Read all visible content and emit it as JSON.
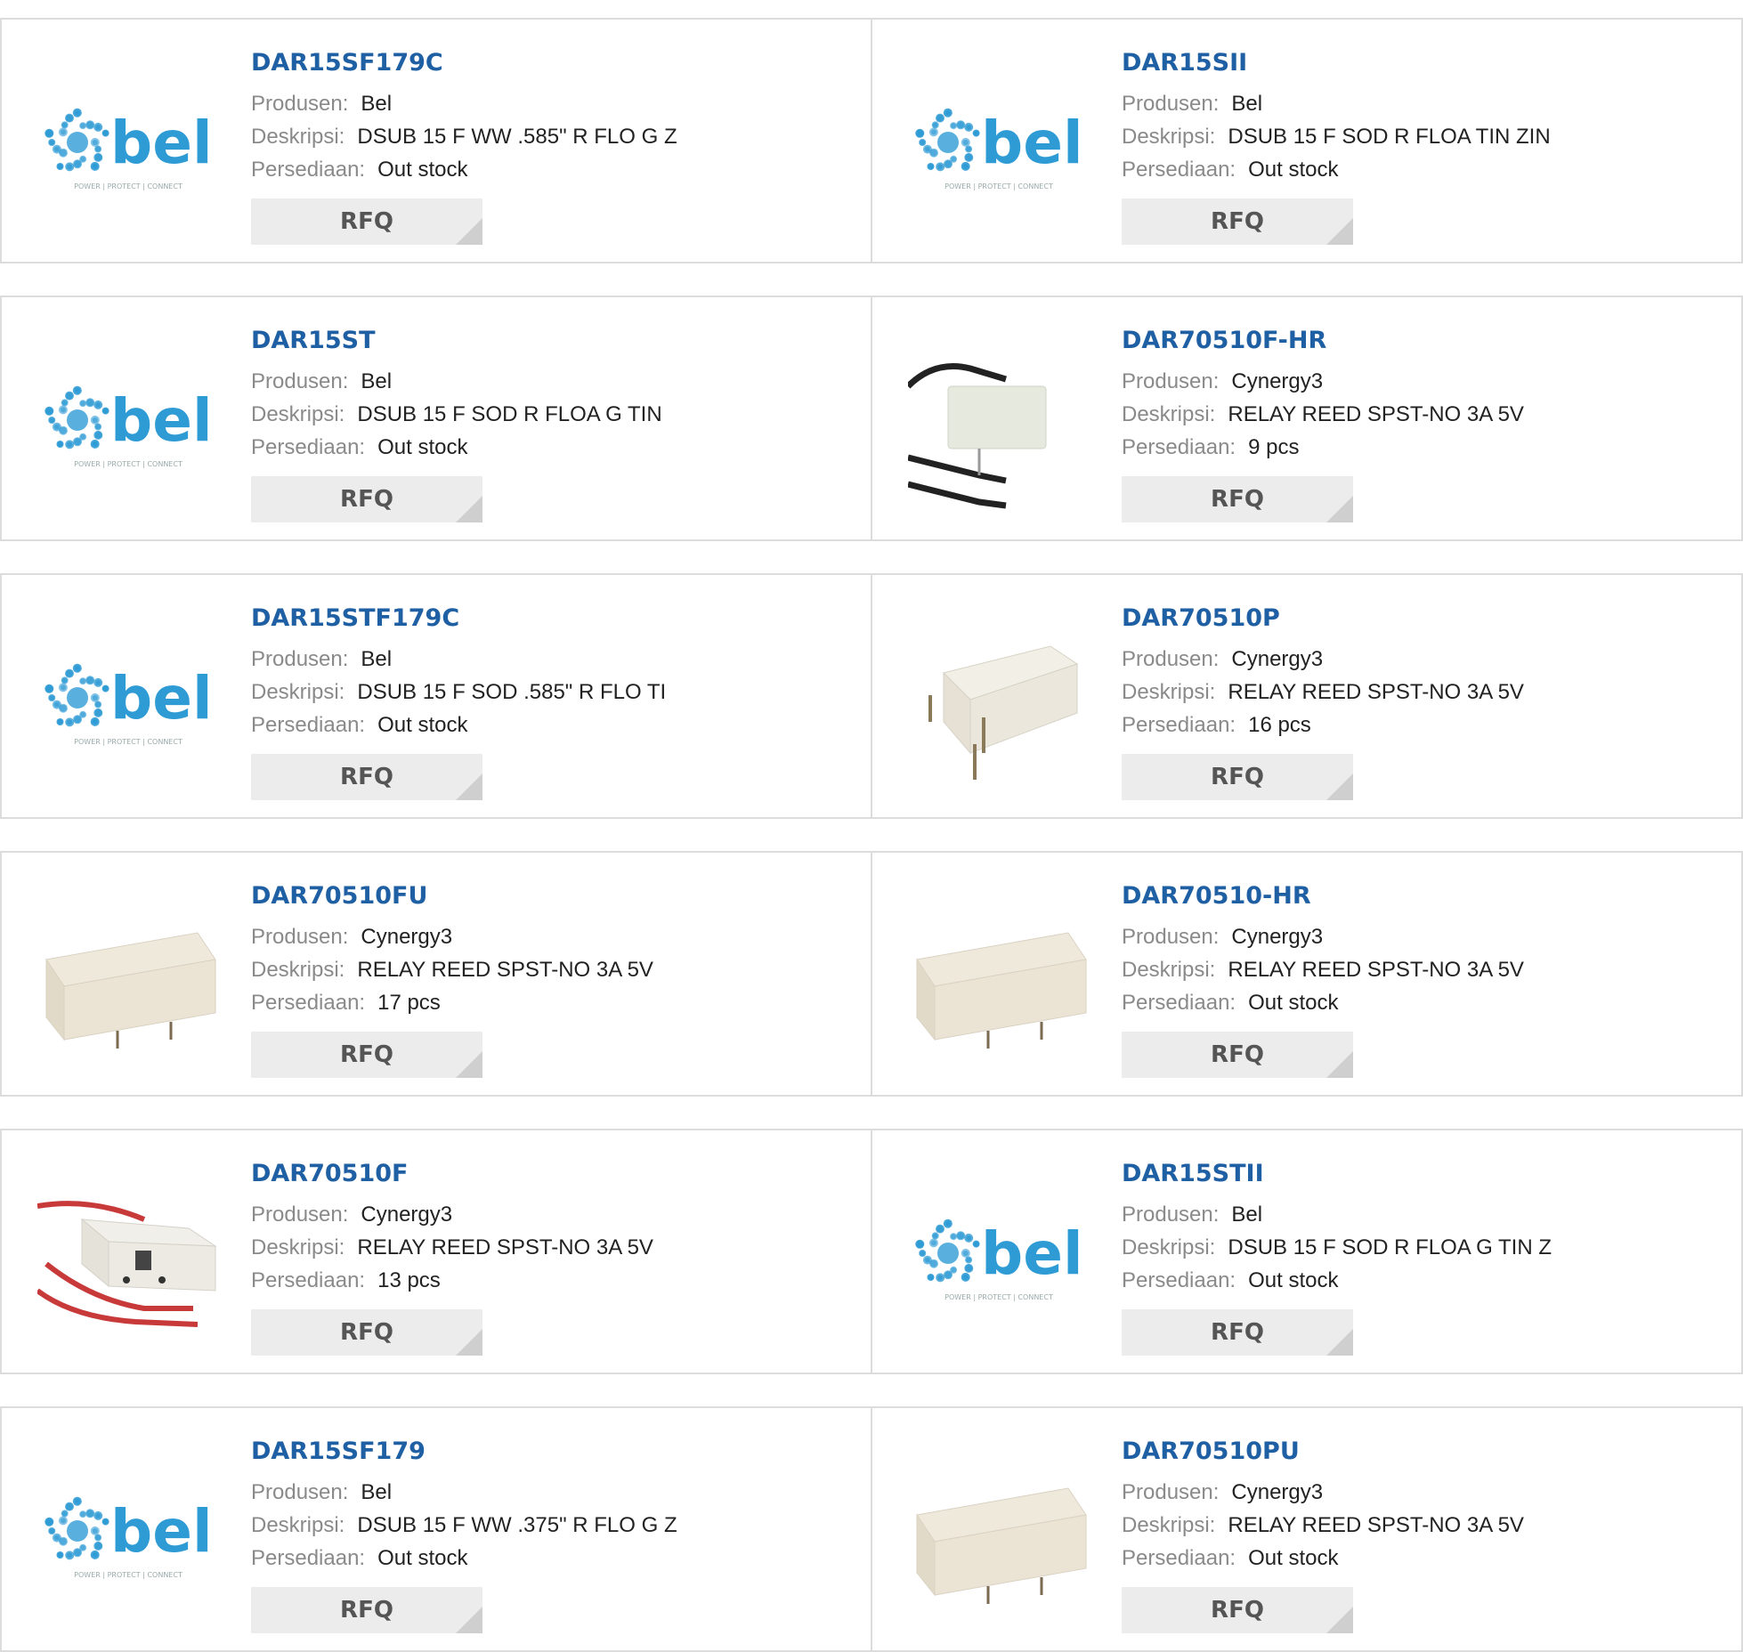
{
  "labels": {
    "manufacturer": "Produsen:",
    "description": "Deskripsi:",
    "stock": "Persediaan:",
    "rfq": "RFQ"
  },
  "colors": {
    "link": "#1f5fa3",
    "border": "#dcdcdc",
    "button": "#ececec",
    "bel_logo": "#2f9bd5"
  },
  "products": [
    {
      "part": "DAR15SF179C",
      "manufacturer": "Bel",
      "description": "DSUB 15 F WW .585\" R FLO G Z",
      "stock": "Out stock",
      "image": "bel-logo"
    },
    {
      "part": "DAR15SII",
      "manufacturer": "Bel",
      "description": "DSUB 15 F SOD R FLOA TIN ZIN",
      "stock": "Out stock",
      "image": "bel-logo"
    },
    {
      "part": "DAR15ST",
      "manufacturer": "Bel",
      "description": "DSUB 15 F SOD R FLOA G TIN",
      "stock": "Out stock",
      "image": "bel-logo"
    },
    {
      "part": "DAR70510F-HR",
      "manufacturer": "Cynergy3",
      "description": "RELAY REED SPST-NO 3A 5V",
      "stock": "9 pcs",
      "image": "relay-black-wires"
    },
    {
      "part": "DAR15STF179C",
      "manufacturer": "Bel",
      "description": "DSUB 15 F SOD .585\" R FLO TI",
      "stock": "Out stock",
      "image": "bel-logo"
    },
    {
      "part": "DAR70510P",
      "manufacturer": "Cynergy3",
      "description": "RELAY REED SPST-NO 3A 5V",
      "stock": "16 pcs",
      "image": "relay-pins"
    },
    {
      "part": "DAR70510FU",
      "manufacturer": "Cynergy3",
      "description": "RELAY REED SPST-NO 3A 5V",
      "stock": "17 pcs",
      "image": "relay-block"
    },
    {
      "part": "DAR70510-HR",
      "manufacturer": "Cynergy3",
      "description": "RELAY REED SPST-NO 3A 5V",
      "stock": "Out stock",
      "image": "relay-block"
    },
    {
      "part": "DAR70510F",
      "manufacturer": "Cynergy3",
      "description": "RELAY REED SPST-NO 3A 5V",
      "stock": "13 pcs",
      "image": "relay-red-wires"
    },
    {
      "part": "DAR15STII",
      "manufacturer": "Bel",
      "description": "DSUB 15 F SOD R FLOA G TIN Z",
      "stock": "Out stock",
      "image": "bel-logo"
    },
    {
      "part": "DAR15SF179",
      "manufacturer": "Bel",
      "description": "DSUB 15 F WW .375\" R FLO G Z",
      "stock": "Out stock",
      "image": "bel-logo"
    },
    {
      "part": "DAR70510PU",
      "manufacturer": "Cynergy3",
      "description": "RELAY REED SPST-NO 3A 5V",
      "stock": "Out stock",
      "image": "relay-block"
    }
  ]
}
